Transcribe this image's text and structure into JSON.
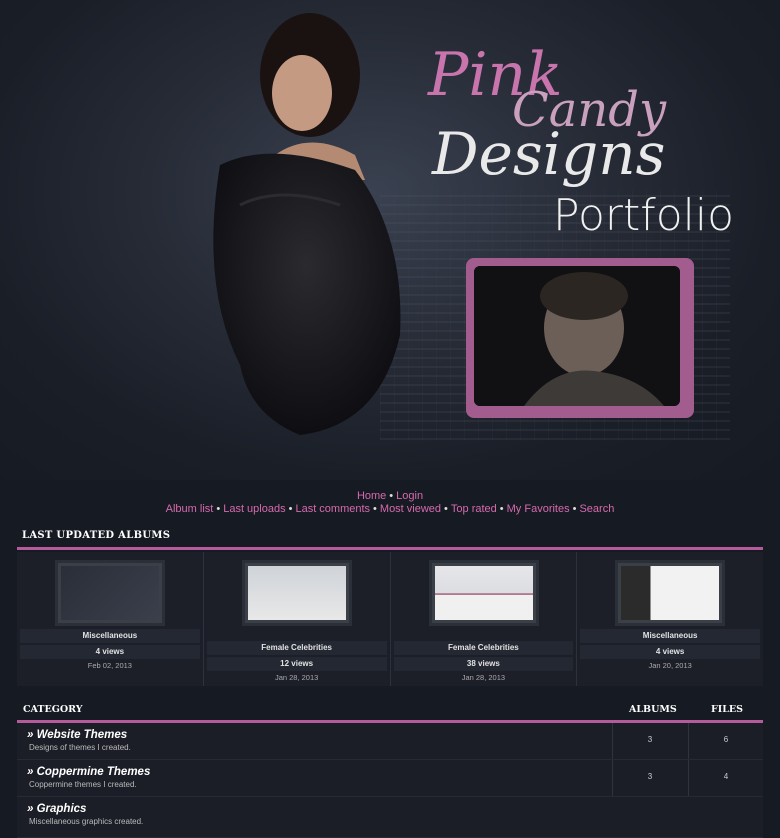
{
  "logo": {
    "pink": "Pink",
    "candy": "Candy",
    "designs": "Designs",
    "portfolio": "Portfolio"
  },
  "nav": {
    "row1": [
      "Home",
      "Login"
    ],
    "row2": [
      "Album list",
      "Last uploads",
      "Last comments",
      "Most viewed",
      "Top rated",
      "My Favorites",
      "Search"
    ]
  },
  "last_updated": {
    "title": "LAST UPDATED ALBUMS",
    "albums": [
      {
        "name": "Miscellaneous",
        "views": "4 views",
        "date": "Feb 02, 2013"
      },
      {
        "name": "Female Celebrities",
        "views": "12 views",
        "date": "Jan 28, 2013"
      },
      {
        "name": "Female Celebrities",
        "views": "38 views",
        "date": "Jan 28, 2013"
      },
      {
        "name": "Miscellaneous",
        "views": "4 views",
        "date": "Jan 20, 2013"
      }
    ]
  },
  "categories": {
    "headers": {
      "category": "CATEGORY",
      "albums": "ALBUMS",
      "files": "FILES"
    },
    "rows": [
      {
        "name": "Website Themes",
        "desc": "Designs of themes I created.",
        "albums": "3",
        "files": "6"
      },
      {
        "name": "Coppermine Themes",
        "desc": "Coppermine themes I created.",
        "albums": "3",
        "files": "4"
      },
      {
        "name": "Graphics",
        "desc": "Miscellaneous graphics created."
      }
    ]
  },
  "colors": {
    "accent": "#b55a9b",
    "link": "#d66aae",
    "background": "#161a22"
  }
}
